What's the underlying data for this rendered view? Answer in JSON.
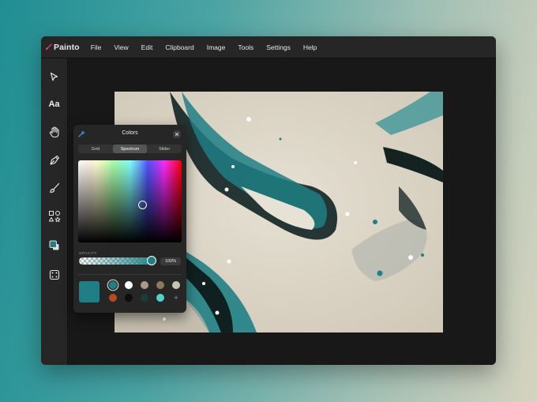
{
  "app": {
    "name": "Painto"
  },
  "menu": [
    "File",
    "View",
    "Edit",
    "Clipboard",
    "Image",
    "Tools",
    "Settings",
    "Help"
  ],
  "tools": [
    {
      "name": "select",
      "icon": "cursor-icon"
    },
    {
      "name": "text",
      "icon": "text-icon",
      "label": "Aa"
    },
    {
      "name": "hand",
      "icon": "hand-icon"
    },
    {
      "name": "pen",
      "icon": "pen-nib-icon"
    },
    {
      "name": "brush",
      "icon": "brush-icon"
    },
    {
      "name": "shapes",
      "icon": "shapes-icon"
    },
    {
      "name": "color",
      "icon": "color-swatch-icon"
    },
    {
      "name": "filters",
      "icon": "dice-icon"
    }
  ],
  "colors_panel": {
    "title": "Colors",
    "tabs": [
      "Grid",
      "Spectrum",
      "Slider"
    ],
    "active_tab": "Spectrum",
    "opacity_label": "OPACITY",
    "opacity_value": "100%",
    "opacity_fraction": 1.0,
    "current_color": "#1f7f85",
    "swatches": [
      "#1f7f85",
      "#ffffff",
      "#a89a86",
      "#8b7a5c",
      "#c8c4b5",
      "#b54b1e",
      "#0c0c0c",
      "#1e3b3a",
      "#4dd4d0"
    ],
    "add_label": "+"
  },
  "colors": {
    "accent": "#1f7f85",
    "window_bg": "#1b1b1b",
    "panel_bg": "#262626"
  }
}
